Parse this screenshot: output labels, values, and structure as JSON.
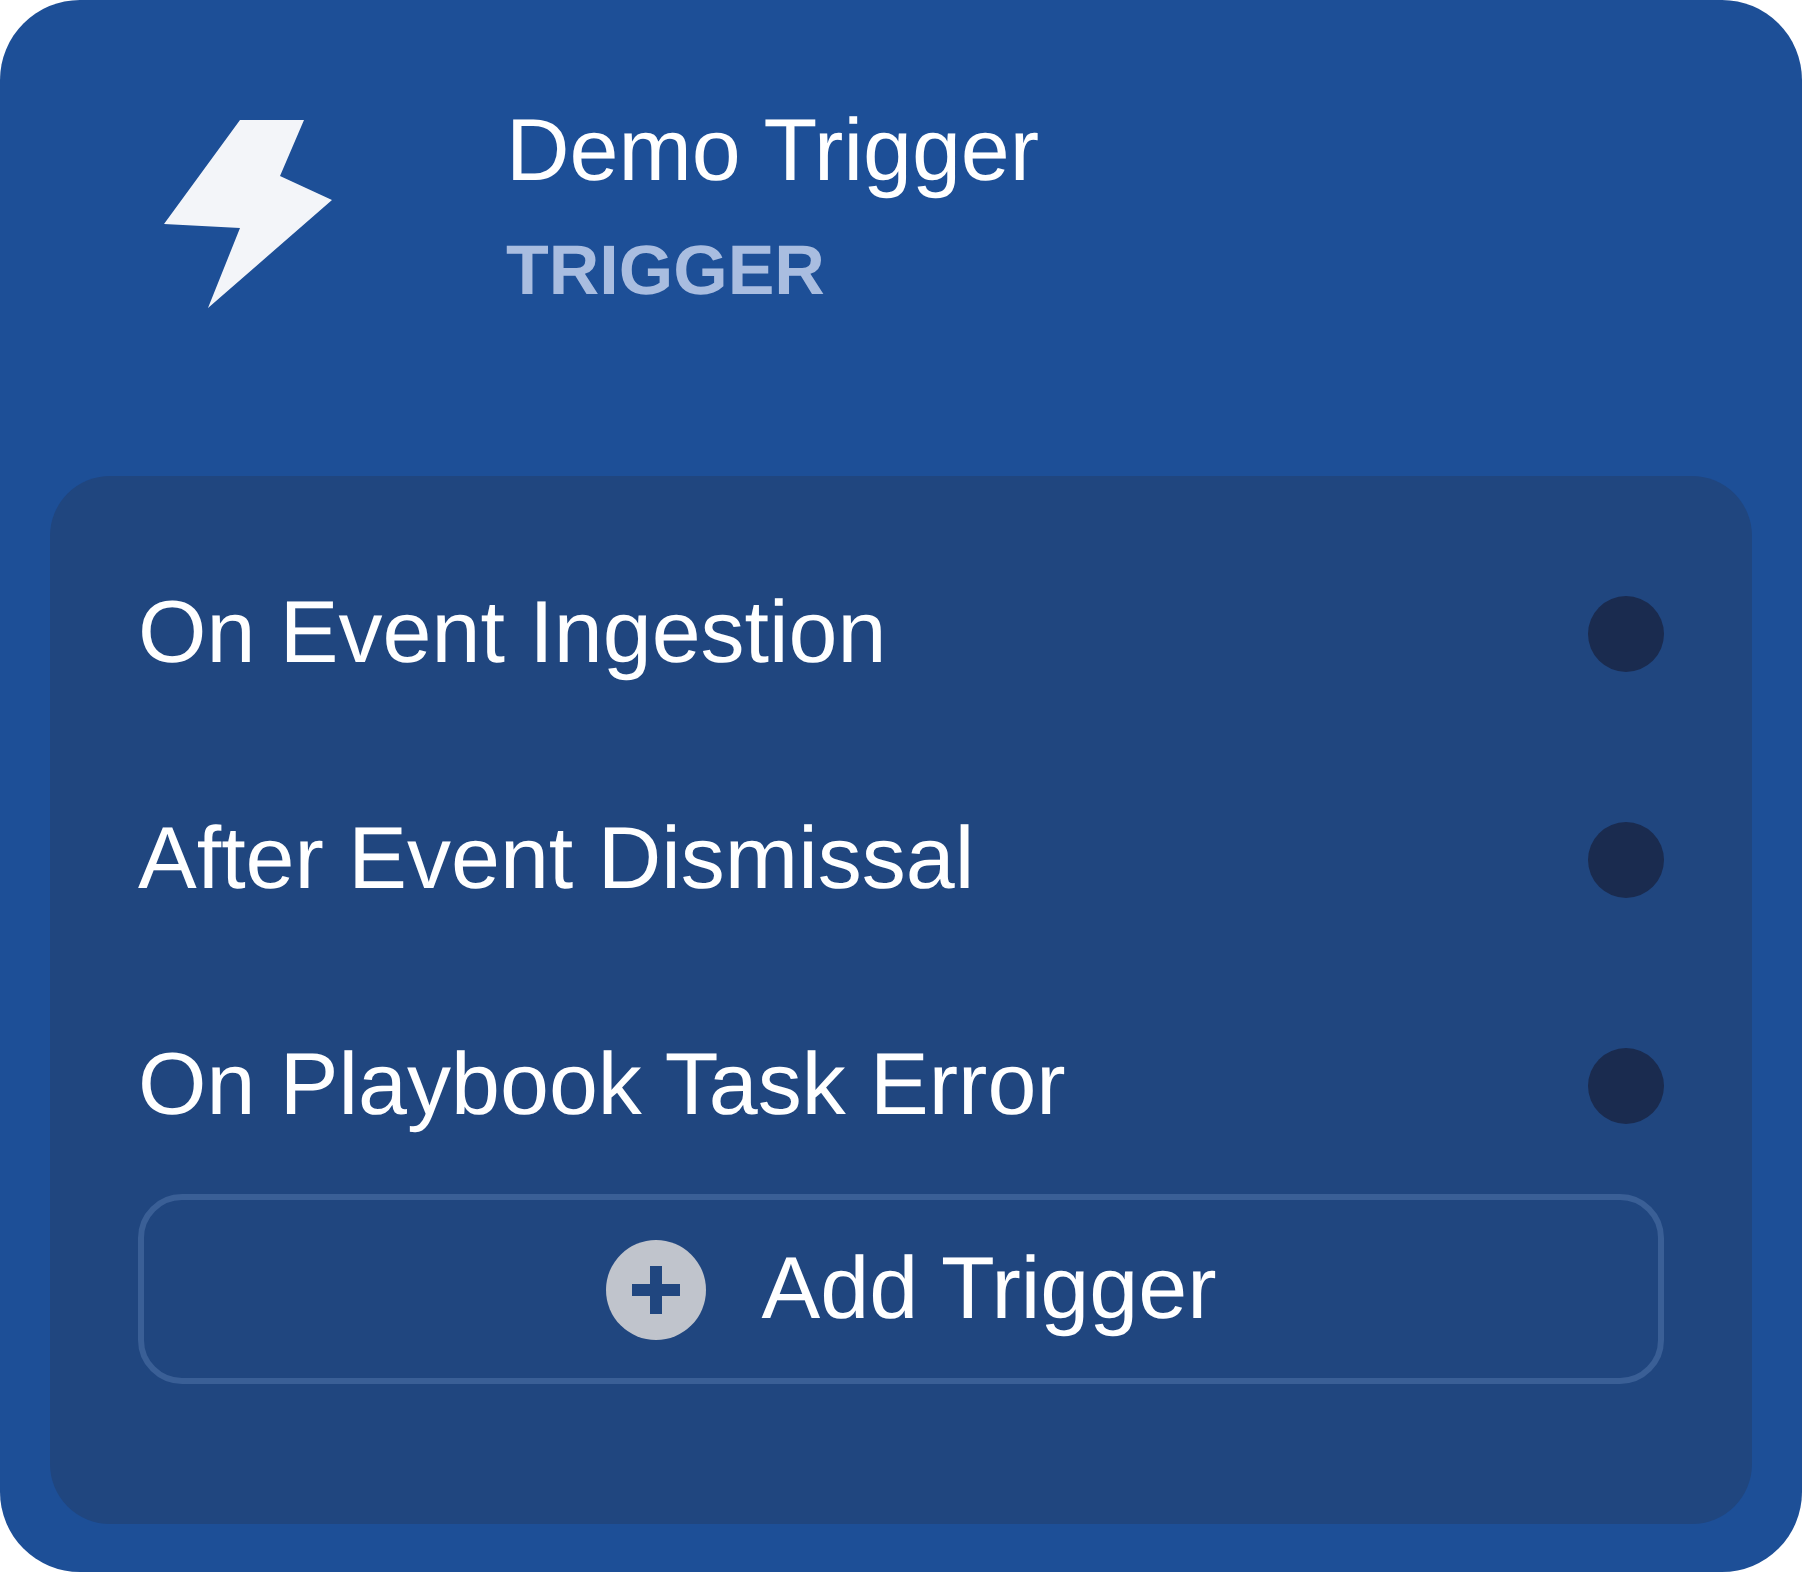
{
  "node": {
    "title": "Demo Trigger",
    "type_label": "TRIGGER"
  },
  "triggers": [
    {
      "label": "On Event Ingestion"
    },
    {
      "label": "After Event Dismissal"
    },
    {
      "label": "On Playbook Task Error"
    }
  ],
  "add_button": {
    "label": "Add Trigger"
  }
}
